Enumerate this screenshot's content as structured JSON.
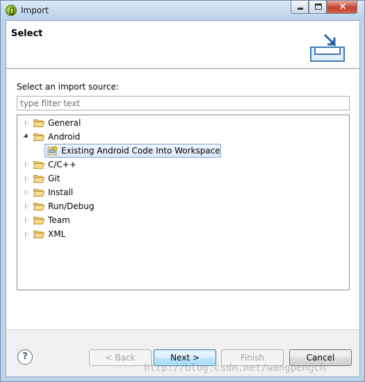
{
  "window": {
    "title": "Import",
    "controls": {
      "minimize": "minimize",
      "maximize": "maximize",
      "close": "close"
    }
  },
  "header": {
    "title": "Select",
    "graphic_icon": "import-tray-icon"
  },
  "content": {
    "source_label": "Select an import source:",
    "filter": {
      "value": "",
      "placeholder": "type filter text"
    },
    "tree": [
      {
        "label": "General",
        "expanded": false,
        "icon": "folder-icon"
      },
      {
        "label": "Android",
        "expanded": true,
        "icon": "folder-icon",
        "children": [
          {
            "label": "Existing Android Code Into Workspace",
            "icon": "android-project-icon",
            "selected": true
          }
        ]
      },
      {
        "label": "C/C++",
        "expanded": false,
        "icon": "folder-icon"
      },
      {
        "label": "Git",
        "expanded": false,
        "icon": "folder-icon"
      },
      {
        "label": "Install",
        "expanded": false,
        "icon": "folder-icon"
      },
      {
        "label": "Run/Debug",
        "expanded": false,
        "icon": "folder-icon"
      },
      {
        "label": "Team",
        "expanded": false,
        "icon": "folder-icon"
      },
      {
        "label": "XML",
        "expanded": false,
        "icon": "folder-icon"
      }
    ]
  },
  "footer": {
    "help_symbol": "?",
    "back_label": "< Back",
    "next_label": "Next >",
    "finish_label": "Finish",
    "cancel_label": "Cancel",
    "watermark": "http://blog.csdn.net/wangpengch"
  },
  "colors": {
    "selection_border": "#7da2ce",
    "default_button_border": "#3c7fb1",
    "folder_yellow": "#e8b64a"
  }
}
